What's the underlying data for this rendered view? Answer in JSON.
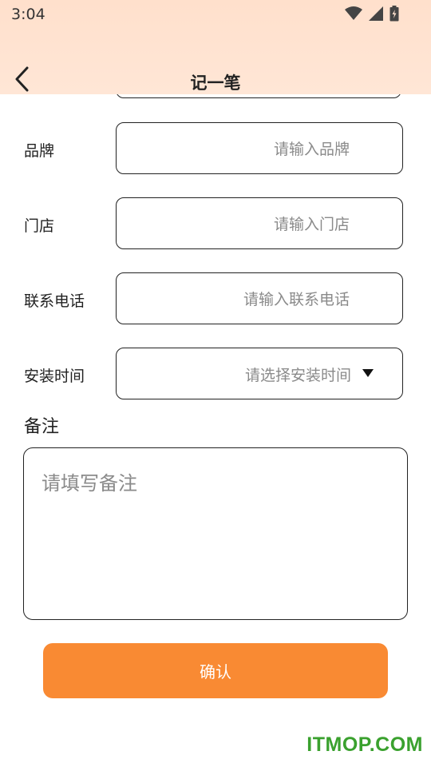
{
  "status_bar": {
    "time": "3:04",
    "icons": [
      "wifi-icon",
      "signal-icon",
      "battery-charging-icon"
    ]
  },
  "header": {
    "back_icon": "chevron-left-icon",
    "title": "记一笔"
  },
  "form": {
    "brand": {
      "label": "品牌",
      "placeholder": "请输入品牌"
    },
    "store": {
      "label": "门店",
      "placeholder": "请输入门店"
    },
    "phone": {
      "label": "联系电话",
      "placeholder": "请输入联系电话"
    },
    "install_time": {
      "label": "安装时间",
      "placeholder": "请选择安装时间",
      "icon": "triangle-down-icon"
    },
    "remark": {
      "label": "备注",
      "placeholder": "请填写备注"
    }
  },
  "actions": {
    "confirm_label": "确认"
  },
  "watermark": "ITMOP.COM",
  "colors": {
    "header_bg": "#ffe2cf",
    "button_bg": "#f98a33",
    "placeholder": "#8a8a8a",
    "watermark": "#3aa12e"
  }
}
